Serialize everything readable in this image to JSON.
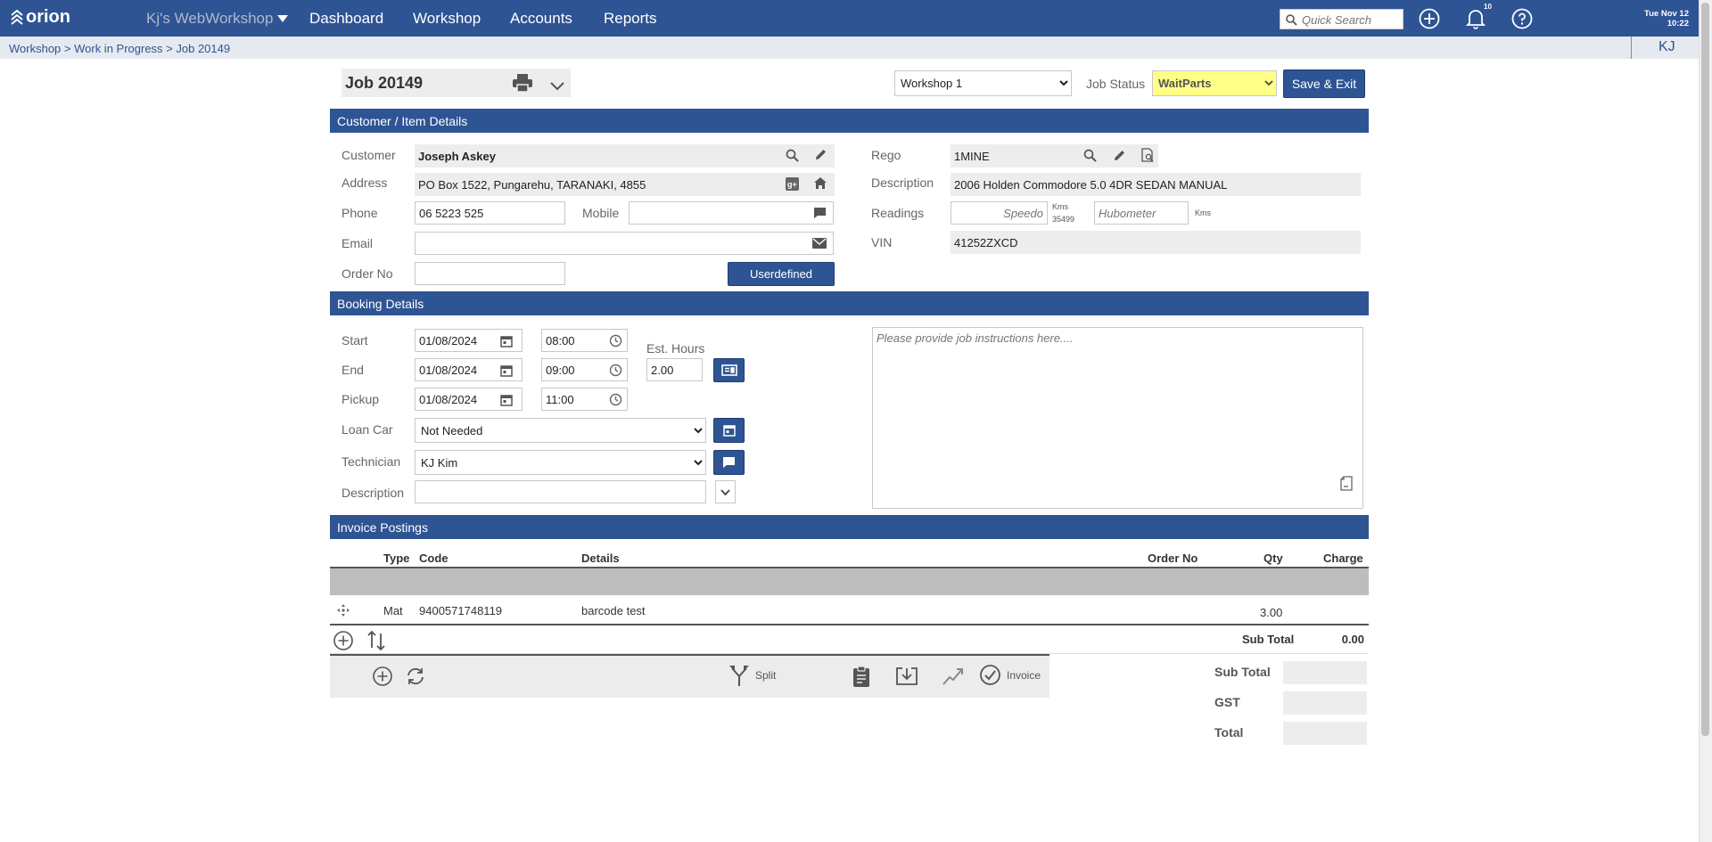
{
  "app": {
    "logo_text": "orion",
    "site_name": "Kj's WebWorkshop",
    "nav": [
      "Dashboard",
      "Workshop",
      "Accounts",
      "Reports"
    ],
    "search_placeholder": "Quick Search",
    "notification_count": "10",
    "date": "Tue Nov 12",
    "time": "10:22",
    "user_initials": "KJ",
    "colors": {
      "primary": "#2e5494",
      "status_highlight": "#ffff88"
    }
  },
  "breadcrumb": "Workshop > Work in Progress > Job 20149",
  "job": {
    "title": "Job 20149",
    "workshop": "Workshop 1",
    "status_label": "Job Status",
    "status": "WaitParts",
    "save_label": "Save & Exit"
  },
  "customer": {
    "section_title": "Customer / Item Details",
    "labels": {
      "customer": "Customer",
      "address": "Address",
      "phone": "Phone",
      "mobile": "Mobile",
      "email": "Email",
      "order_no": "Order No"
    },
    "name": "Joseph Askey",
    "address": "PO Box 1522, Pungarehu, TARANAKI, 4855",
    "phone": "06 5223 525",
    "mobile": "",
    "email": "",
    "order_no": "",
    "userdefined_label": "Userdefined"
  },
  "vehicle": {
    "labels": {
      "rego": "Rego",
      "description": "Description",
      "readings": "Readings",
      "vin": "VIN"
    },
    "rego": "1MINE",
    "description": "2006 Holden Commodore 5.0 4DR SEDAN MANUAL",
    "speedo_placeholder": "Speedo",
    "speedo_unit": "Kms",
    "speedo_last": "35499",
    "hubometer_placeholder": "Hubometer",
    "hubometer_unit": "Kms",
    "vin": "41252ZXCD"
  },
  "booking": {
    "section_title": "Booking Details",
    "labels": {
      "start": "Start",
      "end": "End",
      "pickup": "Pickup",
      "est_hours": "Est. Hours",
      "loan_car": "Loan Car",
      "technician": "Technician",
      "description": "Description"
    },
    "start_date": "01/08/2024",
    "start_time": "08:00",
    "end_date": "01/08/2024",
    "end_time": "09:00",
    "pickup_date": "01/08/2024",
    "pickup_time": "11:00",
    "est_hours": "2.00",
    "loan_car": "Not Needed",
    "technician": "KJ Kim",
    "description": "",
    "instructions_placeholder": "Please provide job instructions here...."
  },
  "invoice": {
    "section_title": "Invoice Postings",
    "columns": [
      "Type",
      "Code",
      "Details",
      "Order No",
      "Qty",
      "Charge"
    ],
    "rows": [
      {
        "type": "Mat",
        "code": "9400571748119",
        "details": "barcode test",
        "order_no": "",
        "qty": "3.00",
        "charge": ""
      }
    ],
    "subtotal_label": "Sub Total",
    "subtotal_value": "0.00",
    "toolbar": {
      "split": "Split",
      "invoice": "Invoice"
    },
    "totals": {
      "sub_total_label": "Sub Total",
      "gst_label": "GST",
      "total_label": "Total",
      "sub_total": "",
      "gst": "",
      "total": ""
    }
  }
}
